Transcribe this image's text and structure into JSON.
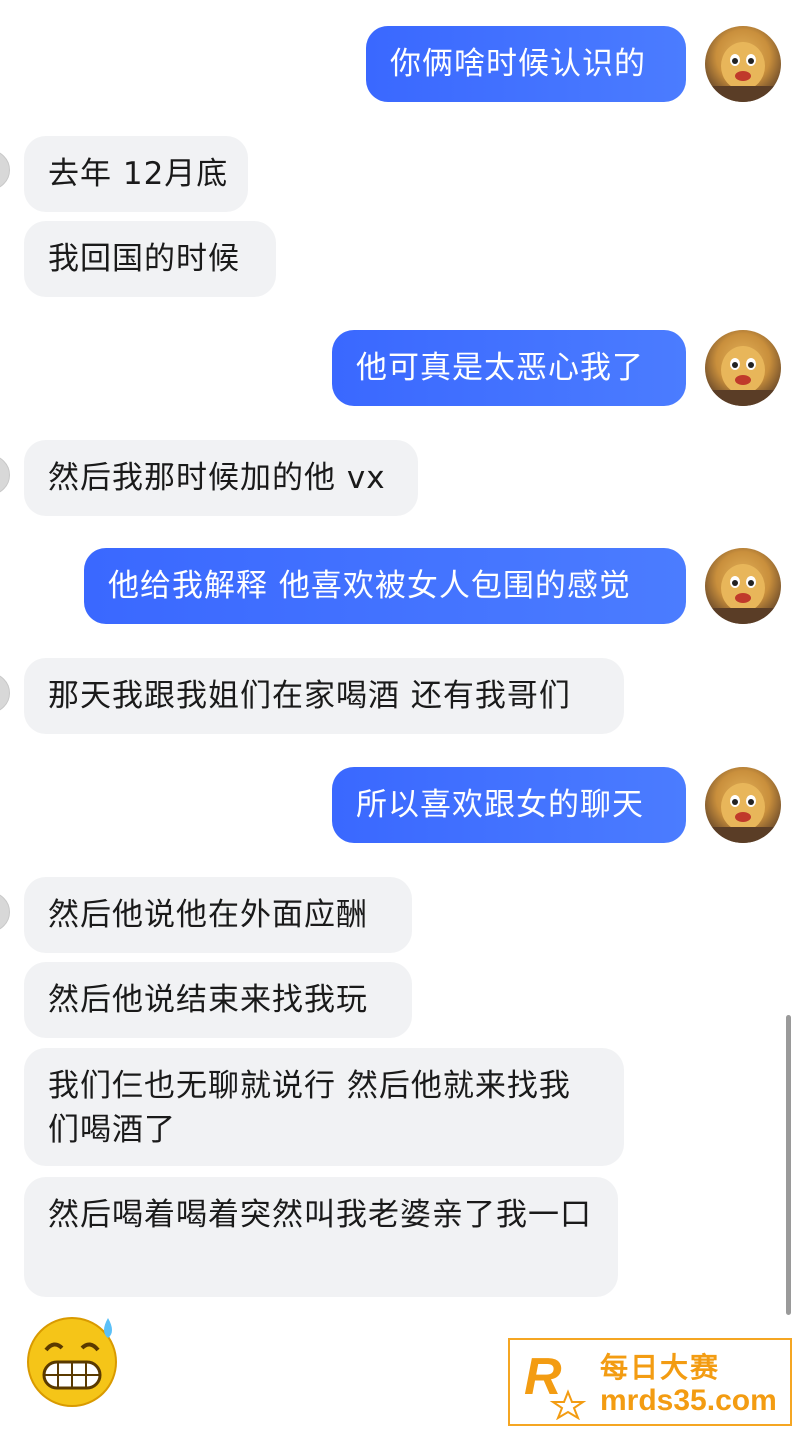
{
  "messages": [
    {
      "side": "out",
      "text": "你俩啥时候认识的"
    },
    {
      "side": "in",
      "text": "去年 12月底"
    },
    {
      "side": "in",
      "text": "我回国的时候"
    },
    {
      "side": "out",
      "text": "他可真是太恶心我了"
    },
    {
      "side": "in",
      "text": "然后我那时候加的他 vx"
    },
    {
      "side": "out",
      "text": "他给我解释 他喜欢被女人包围的感觉"
    },
    {
      "side": "in",
      "text": "那天我跟我姐们在家喝酒 还有我哥们"
    },
    {
      "side": "out",
      "text": "所以喜欢跟女的聊天"
    },
    {
      "side": "in",
      "text": "然后他说他在外面应酬"
    },
    {
      "side": "in",
      "text": "然后他说结束来找我玩"
    },
    {
      "side": "in",
      "text": "我们仨也无聊就说行 然后他就来找我们喝酒了"
    },
    {
      "side": "in",
      "text": "然后喝着喝着突然叫我老婆亲了我一口"
    }
  ],
  "emoji": {
    "icon": "grinning-sweat-emoji-icon"
  },
  "watermark": {
    "logo_letter": "R",
    "logo_small": "每日大赛",
    "title": "每日大赛",
    "url": "mrds35.com",
    "color": "#f39c12"
  },
  "colors": {
    "outgoing": "#3f72ff",
    "incoming": "#f1f2f4"
  }
}
